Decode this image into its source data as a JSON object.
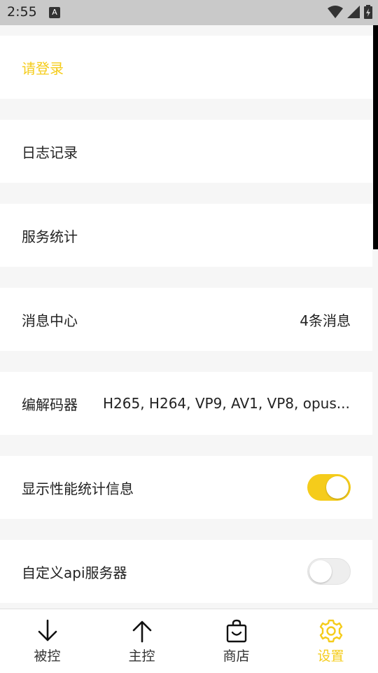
{
  "status_bar": {
    "time": "2:55",
    "notification": "A"
  },
  "settings": {
    "login": "请登录",
    "log": "日志记录",
    "service_stats": "服务统计",
    "message_center": {
      "label": "消息中心",
      "value": "4条消息"
    },
    "codec": {
      "label": "编解码器",
      "value": "H265, H264, VP9, AV1, VP8, opus..."
    },
    "show_perf_stats": {
      "label": "显示性能统计信息",
      "enabled": true
    },
    "custom_api_server": {
      "label": "自定义api服务器",
      "enabled": false
    }
  },
  "bottom_nav": [
    {
      "label": "被控",
      "icon": "arrow-down-icon",
      "active": false
    },
    {
      "label": "主控",
      "icon": "arrow-up-icon",
      "active": false
    },
    {
      "label": "商店",
      "icon": "shopping-bag-icon",
      "active": false
    },
    {
      "label": "设置",
      "icon": "gear-icon",
      "active": true
    }
  ],
  "colors": {
    "accent": "#f5cc1b",
    "background": "#f6f6f6",
    "status_bar": "#c9c9c9"
  }
}
